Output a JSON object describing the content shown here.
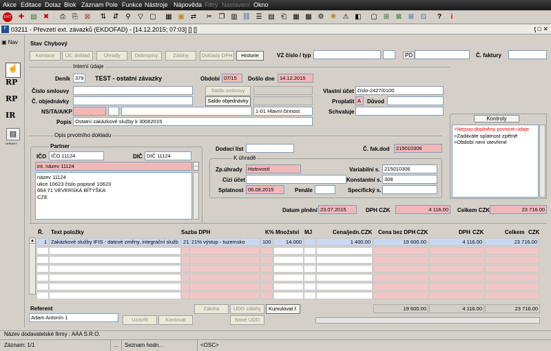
{
  "menu": [
    "Akce",
    "Editace",
    "Dotaz",
    "Blok",
    "Záznam",
    "Pole",
    "Funkce",
    "Nástroje",
    "Nápověda",
    "Filtry",
    "Nastavení",
    "Okno"
  ],
  "menu_disabled": [
    9,
    10
  ],
  "window": {
    "title": "03211 - Převzetí ext. závazků (EKDOFAD) - [14.12.2015; 07:03] [] []",
    "controls": "ƫ □ ✕"
  },
  "sidebar": {
    "nav": "Nav",
    "icons": [
      "RP",
      "RP",
      "IR"
    ],
    "mini_label": "ÚHRADY"
  },
  "stav": {
    "label": "Stav",
    "value": "Chybový"
  },
  "tabs": [
    "Kontace",
    "Úč. doklad",
    "Úhrady",
    "Dobropisy",
    "Zálohy",
    "Doklady DPH",
    "Historie"
  ],
  "header_fields": {
    "vz_label": "VZ číslo / typ",
    "pd_label": "PD",
    "cf_label": "Č. faktury"
  },
  "internal": {
    "section": "Interní údaje",
    "denik_label": "Deník",
    "denik_value": "379",
    "denik_name": "TEST - ostatní závazky",
    "obdobi_label": "Období",
    "obdobi_value": "07/15",
    "doslo_label": "Došlo dne",
    "doslo_value": "14.12.2015",
    "smlouva_label": "Číslo smlouvy",
    "objednavka_label": "Č. objednávky",
    "saldo_smlouvy": "Saldo smlouvy",
    "saldo_objednavky": "Saldo objednávky",
    "vlastni_label": "Vlastní účet",
    "vlastni_value": "číslo-2427/0100",
    "proplatit_label": "Proplatit",
    "proplatit_value": "A",
    "duvod_label": "Důvod",
    "nsta_label": "NS/TA/A/KP",
    "nsta_value": "1-01 Hlavní činnost",
    "schvaluje_label": "Schvaluje",
    "popis_label": "Popis",
    "popis_value": "Ostatní zakázkové služby k 30062015"
  },
  "kontroly": {
    "title": "Kontroly",
    "items": [
      ">Nejsou doplněny povinné údaje",
      ">Zadáváte splatnost zpětně",
      ">Období není otevřené"
    ]
  },
  "original": {
    "section": "Opis prvotního dokladu",
    "partner_label": "Partner",
    "ico_label": "IČO",
    "ico_value": "IČO 11124",
    "dic_label": "DIČ",
    "dic_value": "DIČ 11124",
    "int_nazev": "int. název 11124",
    "address": [
      "název 11124",
      "ulice 10623 číslo popisné 10623",
      "664 71 VEVERSKÁ BÍTÝŠKA",
      "CZE"
    ],
    "dodaci_label": "Dodací list",
    "cfak_label": "Č. fak.dod",
    "cfak_value": "215010306",
    "k_uhrade": "K úhradě",
    "zp_label": "Zp.úhrady",
    "zp_value": "Hotovostí",
    "cizi_label": "Cizí účet",
    "splatnost_label": "Splatnost",
    "splatnost_value": "06.08.2015",
    "penale_label": "Penále",
    "var_label": "Variabilní s.",
    "var_value": "215010306",
    "konst_label": "Konstantní s.",
    "konst_value": "308",
    "spec_label": "Specifický s."
  },
  "totals": {
    "plneni_label": "Datum plnění",
    "plneni_value": "23.07.2015",
    "dph_label": "DPH CZK",
    "dph_value": "4 116.00",
    "celkem_label": "Celkem CZK",
    "celkem_value": "23 716.00"
  },
  "grid": {
    "headers": {
      "r": "Ř.",
      "text": "Text položky",
      "sazba": "Sazba DPH",
      "kp": "K%",
      "mnozstvi": "Množství",
      "mj": "MJ",
      "cena": "Cena/jedn.",
      "czk1": "CZK",
      "bez": "Cena bez DPH",
      "czk2": "CZK",
      "dph": "DPH",
      "czk3": "CZK",
      "celkem": "Celkem",
      "czk4": "CZK"
    },
    "row": {
      "r": "1",
      "text": "Zakázkové služby IFIS - datové změny, integrační služb",
      "sazba_code": "21",
      "sazba": "21% výstup - tuzemsko",
      "kp": "100",
      "mnozstvi": "14.000",
      "cena": "1 400.00",
      "bez": "19 600.00",
      "dph": "4 116.00",
      "celkem": "23 716.00"
    },
    "sum": {
      "bez": "19 600.00",
      "dph": "4 116.00",
      "celkem": "23 716.00"
    }
  },
  "footer": {
    "referent_label": "Referent",
    "referent_value": "Adam Antonín 1",
    "uzavrit": "Uzavřít",
    "kontovat": "Kontovat",
    "zaloha": "Záloha",
    "udd": "UDD zálohy",
    "kumulovat": "Kumulovat ř.",
    "nove_udd": "Nové UDD"
  },
  "status": {
    "nazev": "Název dodavatelské firmy : AAA S.R.O.",
    "zaznam": "Záznam: 1/1",
    "dots": "...",
    "seznam": "Seznam hodn...",
    "osc": "<OSC>"
  }
}
